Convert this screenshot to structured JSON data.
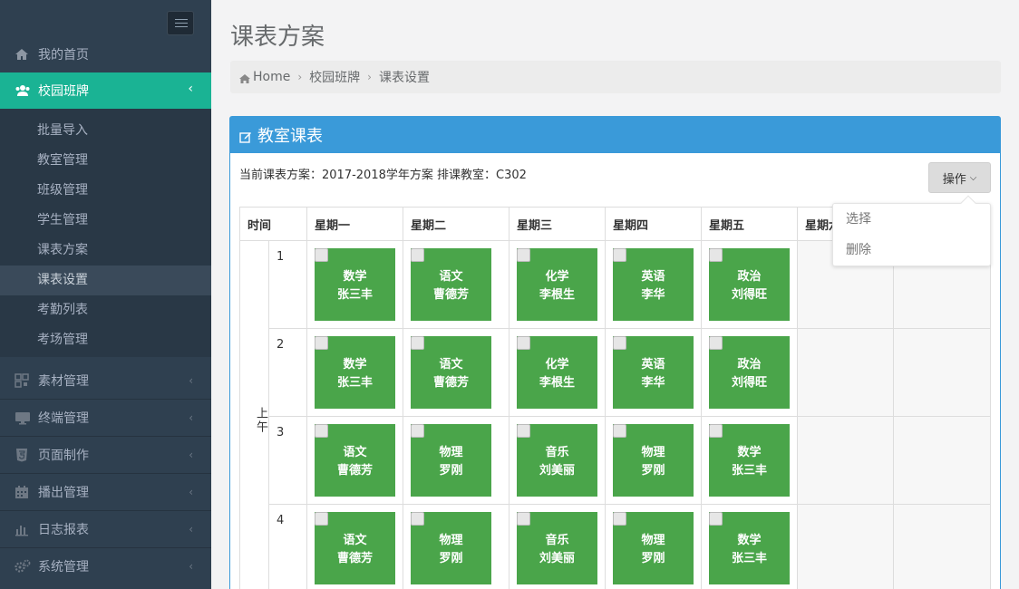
{
  "sidebar": {
    "home": "我的首页",
    "campus": "校园班牌",
    "sub": [
      "批量导入",
      "教室管理",
      "班级管理",
      "学生管理",
      "课表方案",
      "课表设置",
      "考勤列表",
      "考场管理"
    ],
    "groups": [
      "素材管理",
      "终端管理",
      "页面制作",
      "播出管理",
      "日志报表",
      "系统管理"
    ],
    "chevron": "‹"
  },
  "header": {
    "title": "课表方案"
  },
  "breadcrumb": {
    "home": "Home",
    "level1": "校园班牌",
    "level2": "课表设置",
    "sep": "›"
  },
  "panel": {
    "title": "教室课表",
    "info": "当前课表方案：2017-2018学年方案   排课教室：C302",
    "ops_label": "操作",
    "ops_caret": "⌵",
    "dropdown": [
      "选择",
      "删除"
    ]
  },
  "table": {
    "headers": [
      "时间",
      "星期一",
      "星期二",
      "星期三",
      "星期四",
      "星期五",
      "星期六",
      ""
    ],
    "ampm": "上午",
    "periods": [
      "1",
      "2",
      "3",
      "4"
    ],
    "rows": [
      [
        [
          "数学",
          "张三丰"
        ],
        [
          "语文",
          "曹德芳"
        ],
        [
          "化学",
          "李根生"
        ],
        [
          "英语",
          "李华"
        ],
        [
          "政治",
          "刘得旺"
        ]
      ],
      [
        [
          "数学",
          "张三丰"
        ],
        [
          "语文",
          "曹德芳"
        ],
        [
          "化学",
          "李根生"
        ],
        [
          "英语",
          "李华"
        ],
        [
          "政治",
          "刘得旺"
        ]
      ],
      [
        [
          "语文",
          "曹德芳"
        ],
        [
          "物理",
          "罗刚"
        ],
        [
          "音乐",
          "刘美丽"
        ],
        [
          "物理",
          "罗刚"
        ],
        [
          "数学",
          "张三丰"
        ]
      ],
      [
        [
          "语文",
          "曹德芳"
        ],
        [
          "物理",
          "罗刚"
        ],
        [
          "音乐",
          "刘美丽"
        ],
        [
          "物理",
          "罗刚"
        ],
        [
          "数学",
          "张三丰"
        ]
      ]
    ]
  },
  "colors": {
    "sidebar": "#2f4050",
    "active": "#1ab394",
    "panel": "#3a9ad9",
    "lesson": "#4aa54a"
  }
}
